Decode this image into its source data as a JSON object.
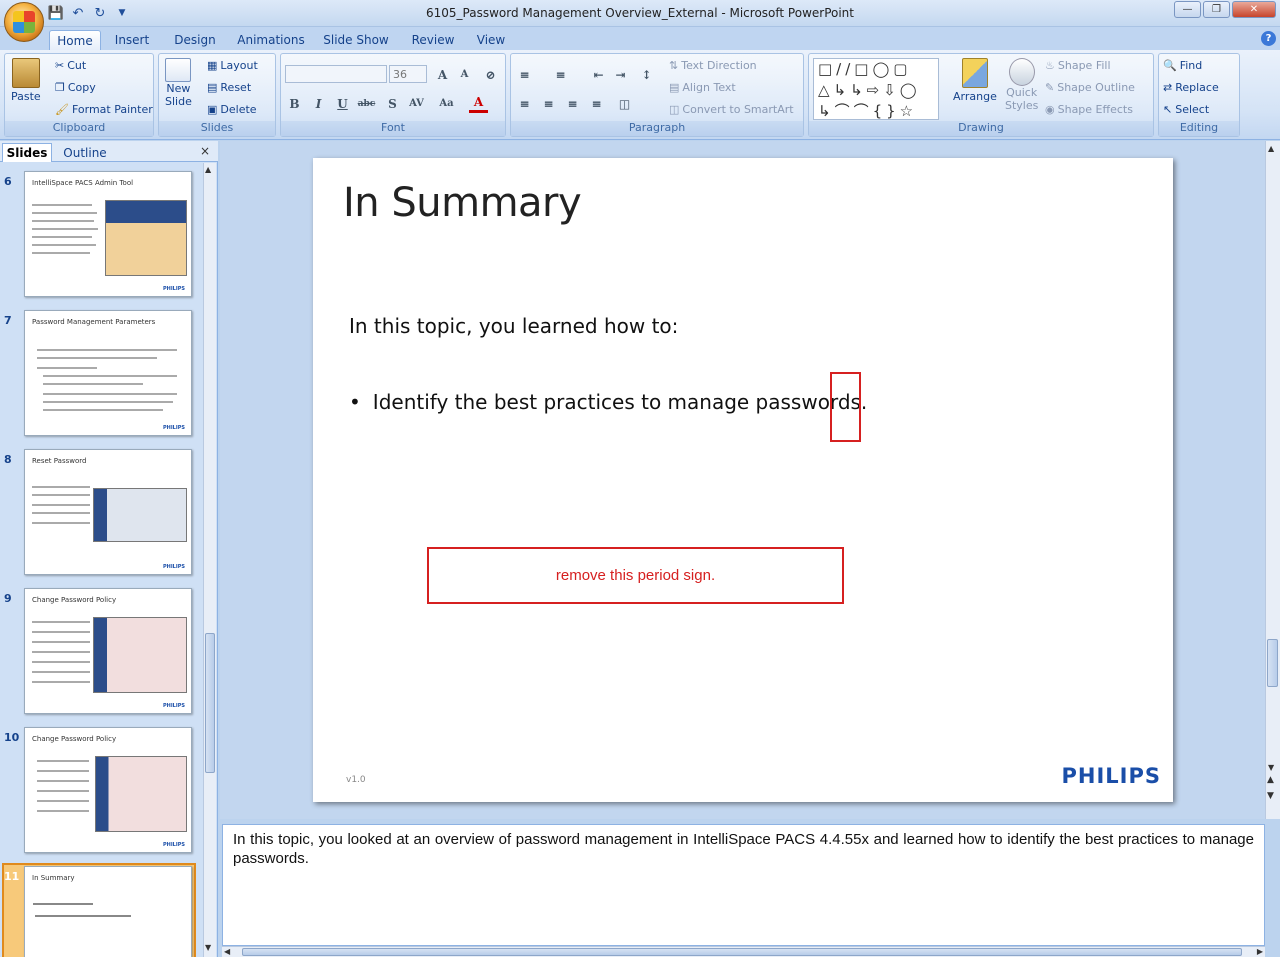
{
  "window": {
    "title": "6105_Password Management Overview_External - Microsoft PowerPoint"
  },
  "tabs": [
    "Home",
    "Insert",
    "Design",
    "Animations",
    "Slide Show",
    "Review",
    "View"
  ],
  "ribbon": {
    "clipboard": {
      "label": "Clipboard",
      "paste": "Paste",
      "cut": "Cut",
      "copy": "Copy",
      "format_painter": "Format Painter"
    },
    "slides": {
      "label": "Slides",
      "new_slide_1": "New",
      "new_slide_2": "Slide",
      "layout": "Layout",
      "reset": "Reset",
      "delete": "Delete"
    },
    "font": {
      "label": "Font",
      "font_name": "",
      "font_size": "36"
    },
    "paragraph": {
      "label": "Paragraph",
      "text_direction": "Text Direction",
      "align_text": "Align Text",
      "convert_smartart": "Convert to SmartArt"
    },
    "drawing": {
      "label": "Drawing",
      "arrange": "Arrange",
      "quick_styles_1": "Quick",
      "quick_styles_2": "Styles",
      "shape_fill": "Shape Fill",
      "shape_outline": "Shape Outline",
      "shape_effects": "Shape Effects"
    },
    "editing": {
      "label": "Editing",
      "find": "Find",
      "replace": "Replace",
      "select": "Select"
    }
  },
  "left_pane": {
    "tab_slides": "Slides",
    "tab_outline": "Outline",
    "thumbnails": [
      {
        "num": "6",
        "title": "IntelliSpace PACS Admin Tool"
      },
      {
        "num": "7",
        "title": "Password Management  Parameters"
      },
      {
        "num": "8",
        "title": "Reset Password"
      },
      {
        "num": "9",
        "title": "Change Password  Policy"
      },
      {
        "num": "10",
        "title": "Change Password  Policy"
      },
      {
        "num": "11",
        "title": "In Summary"
      }
    ]
  },
  "slide": {
    "title": "In Summary",
    "intro": "In this topic, you learned how to:",
    "bullet": "Identify the best practices to manage passwords.",
    "version": "v1.0",
    "logo": "PHILIPS"
  },
  "review_comment": "remove this period sign.",
  "notes": "In this topic, you looked at an overview of password management  in IntelliSpace PACS 4.4.55x and learned how to identify the best practices to manage passwords.",
  "colors": {
    "annotation": "#d62020",
    "philips_blue": "#1a4ea8",
    "selection": "#f7c97a"
  }
}
